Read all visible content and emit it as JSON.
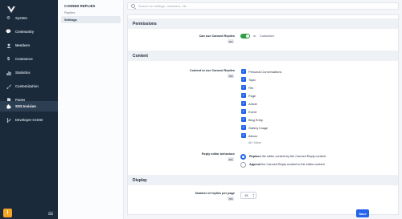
{
  "nav": {
    "items": [
      {
        "label": "System",
        "icon": "gear-icon"
      },
      {
        "label": "Community",
        "icon": "chat-bubbles-icon"
      },
      {
        "label": "Members",
        "icon": "user-icon"
      },
      {
        "label": "Commerce",
        "icon": "dollar-icon"
      },
      {
        "label": "Statistics",
        "icon": "bar-chart-icon"
      },
      {
        "label": "Customization",
        "icon": "paint-brush-icon"
      },
      {
        "label": "Pages",
        "icon": "document-icon"
      },
      {
        "label": "SOS Invision",
        "icon": "puzzle-icon"
      },
      {
        "label": "Developer Center",
        "icon": "code-branch-icon"
      }
    ],
    "active_index": 7
  },
  "submenu": {
    "heading": "CANNED REPLIES",
    "links": [
      "Replies"
    ],
    "selected": "Settings"
  },
  "search": {
    "placeholder": "Search for settings, members, etc."
  },
  "sections": {
    "permissions": "Permissions",
    "content": "Content",
    "display": "Display"
  },
  "permissions": {
    "can_use_label": "Can use Canned Replies",
    "badge": "{%}",
    "or_text": "or",
    "customize_text": "Customize",
    "enabled": true
  },
  "content": {
    "label": "Content to use Canned Replies",
    "badge": "{%}",
    "options": [
      "Personal Conversations",
      "Topic",
      "File",
      "Page",
      "Article",
      "Event",
      "Blog Entry",
      "Gallery Image",
      "Album"
    ],
    "all_none": "All / None",
    "reply_label": "Reply editor behaviour",
    "reply_badge": "{%}",
    "replace_bold": "Replace",
    "replace_rest": "the editor content by the Canned Reply content",
    "append_bold": "Append",
    "append_rest": "the Canned Reply content to the editor content",
    "selected_radio": "replace"
  },
  "display": {
    "label": "Number of replies per page",
    "badge": "{%}",
    "value": "15"
  },
  "save_label": "Save",
  "colors": {
    "accent": "#2563eb",
    "toggle_on": "#2f9e44",
    "nav_bg": "#1b2a3a"
  }
}
